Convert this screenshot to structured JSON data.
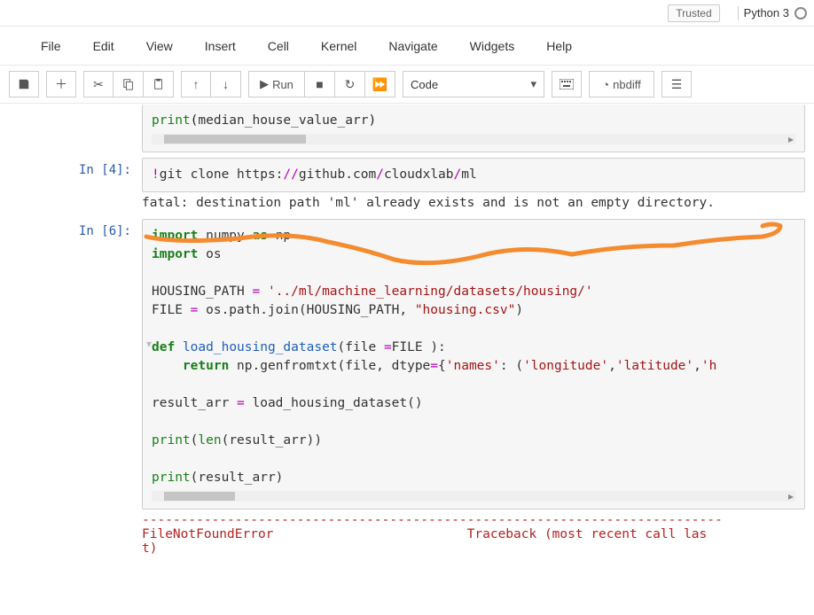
{
  "header": {
    "trusted": "Trusted",
    "kernel_name": "Python 3"
  },
  "menu": {
    "items": [
      "File",
      "Edit",
      "View",
      "Insert",
      "Cell",
      "Kernel",
      "Navigate",
      "Widgets",
      "Help"
    ]
  },
  "toolbar": {
    "run_label": "Run",
    "nbdiff_label": "nbdiff",
    "celltype": "Code"
  },
  "cells": [
    {
      "prompt": "",
      "code_plain": "print(median_house_value_arr)"
    },
    {
      "prompt": "In [4]:",
      "code_plain": "!git clone https://github.com/cloudxlab/ml",
      "output": "fatal: destination path 'ml' already exists and is not an empty directory."
    },
    {
      "prompt": "In [6]:",
      "code_plain": "import numpy as np\nimport os\n\nHOUSING_PATH = '../ml/machine_learning/datasets/housing/'\nFILE = os.path.join(HOUSING_PATH, \"housing.csv\")\n\ndef load_housing_dataset(file =FILE ):\n    return np.genfromtxt(file, dtype={'names': ('longitude','latitude','h\n\nresult_arr = load_housing_dataset()\n\nprint(len(result_arr))\n\nprint(result_arr)",
      "error_lines": [
        "---------------------------------------------------------------------------",
        "FileNotFoundError                         Traceback (most recent call las",
        "t)"
      ]
    }
  ]
}
